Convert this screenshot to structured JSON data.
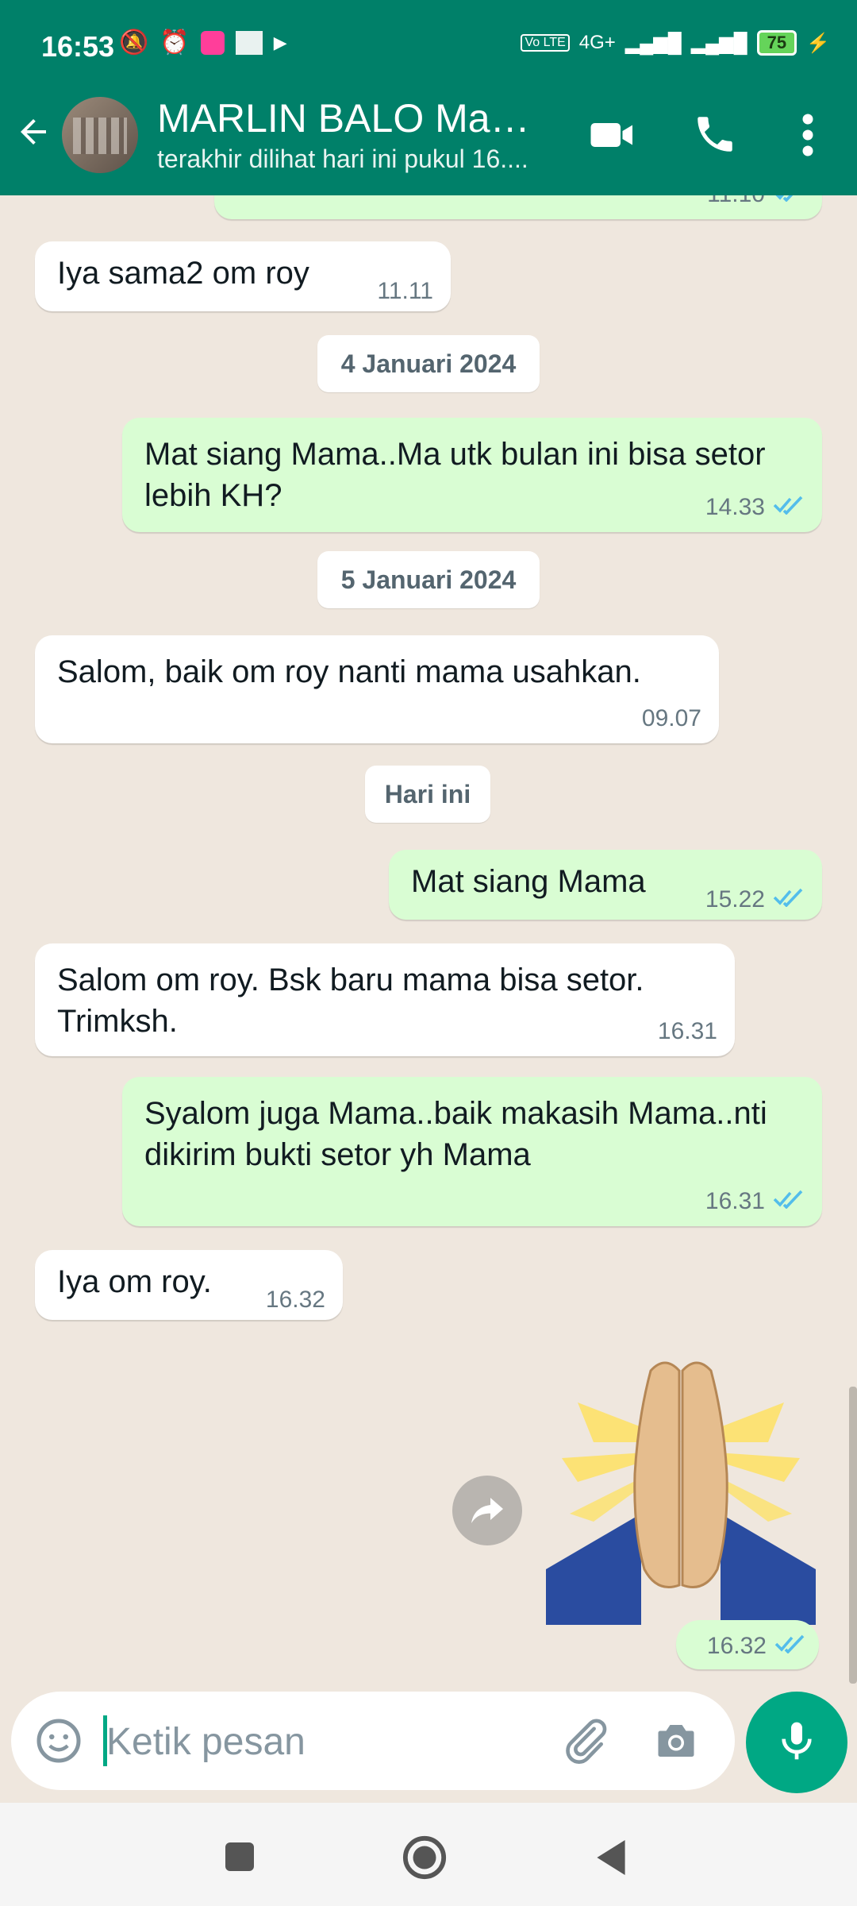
{
  "status_bar": {
    "time": "16:53",
    "battery": "75",
    "network": "4G+"
  },
  "header": {
    "contact_name": "MARLIN BALO Mam...",
    "status": "terakhir dilihat hari ini pukul 16...."
  },
  "messages": [
    {
      "type": "in",
      "text": "Iya sama2 om roy",
      "time": "11.11"
    },
    {
      "type": "date",
      "text": "4 Januari 2024"
    },
    {
      "type": "out",
      "text": "Mat siang Mama..Ma utk bulan ini bisa setor lebih KH?",
      "time": "14.33"
    },
    {
      "type": "date",
      "text": "5 Januari 2024"
    },
    {
      "type": "in",
      "text": "Salom, baik om roy nanti mama usahkan.",
      "time": "09.07"
    },
    {
      "type": "date",
      "text": "Hari ini"
    },
    {
      "type": "out",
      "text": "Mat siang Mama",
      "time": "15.22"
    },
    {
      "type": "in",
      "text": "Salom om roy. Bsk baru mama bisa setor. Trimksh.",
      "time": "16.31"
    },
    {
      "type": "out",
      "text": "Syalom juga Mama..baik makasih Mama..nti dikirim bukti setor yh Mama",
      "time": "16.31"
    },
    {
      "type": "in",
      "text": "Iya om roy.",
      "time": "16.32"
    },
    {
      "type": "sticker",
      "time": "16.32"
    }
  ],
  "partial_top_message_time": "11.10",
  "input": {
    "placeholder": "Ketik pesan"
  },
  "colors": {
    "header": "#008069",
    "outgoing": "#d9fdd3",
    "incoming": "#ffffff",
    "accent": "#00a884",
    "ticks": "#53bdeb"
  }
}
